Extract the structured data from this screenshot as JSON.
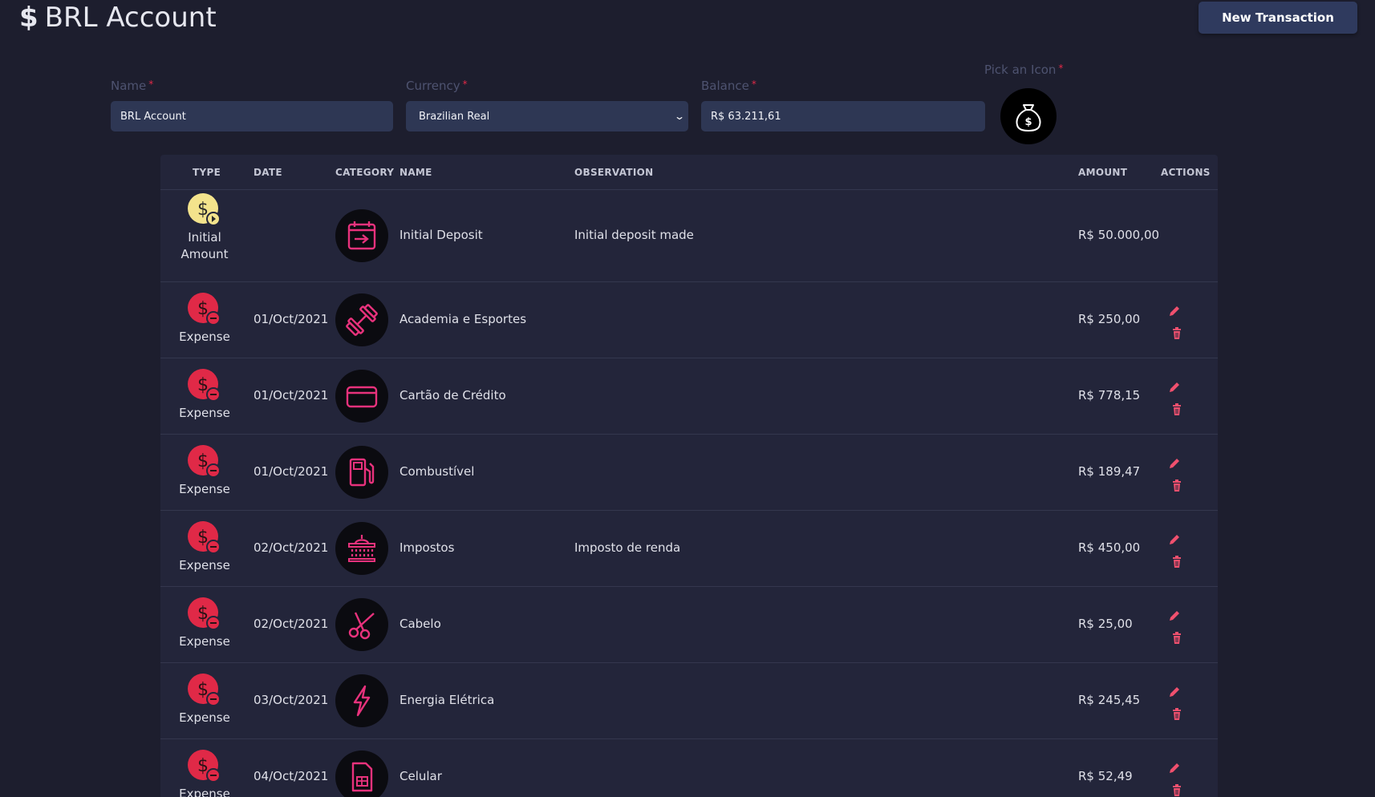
{
  "header": {
    "title": "BRL Account",
    "title_icon": "dollar-icon",
    "new_transaction_label": "New Transaction"
  },
  "form": {
    "name_label": "Name",
    "name_value": "BRL Account",
    "currency_label": "Currency",
    "currency_value": "Brazilian Real",
    "balance_label": "Balance",
    "balance_value": "R$ 63.211,61",
    "icon_label": "Pick an Icon",
    "icon_selected": "money-bag-icon",
    "required_marker": "*"
  },
  "table": {
    "columns": {
      "type": "TYPE",
      "date": "DATE",
      "category": "CATEGORY",
      "name": "NAME",
      "observation": "OBSERVATION",
      "amount": "AMOUNT",
      "actions": "ACTIONS"
    },
    "rows": [
      {
        "type": "Initial Amount",
        "type_icon": "initial-amount-icon",
        "date": "",
        "category_icon": "calendar-arrow-icon",
        "name": "Initial Deposit",
        "observation": "Initial deposit made",
        "amount": "R$ 50.000,00"
      },
      {
        "type": "Expense",
        "type_icon": "expense-icon",
        "date": "01/Oct/2021",
        "category_icon": "dumbbell-icon",
        "name": "Academia e Esportes",
        "observation": "",
        "amount": "R$ 250,00"
      },
      {
        "type": "Expense",
        "type_icon": "expense-icon",
        "date": "01/Oct/2021",
        "category_icon": "credit-card-icon",
        "name": "Cartão de Crédito",
        "observation": "",
        "amount": "R$ 778,15"
      },
      {
        "type": "Expense",
        "type_icon": "expense-icon",
        "date": "01/Oct/2021",
        "category_icon": "fuel-pump-icon",
        "name": "Combustível",
        "observation": "",
        "amount": "R$ 189,47"
      },
      {
        "type": "Expense",
        "type_icon": "expense-icon",
        "date": "02/Oct/2021",
        "category_icon": "government-building-icon",
        "name": "Impostos",
        "observation": "Imposto de renda",
        "amount": "R$ 450,00"
      },
      {
        "type": "Expense",
        "type_icon": "expense-icon",
        "date": "02/Oct/2021",
        "category_icon": "scissors-icon",
        "name": "Cabelo",
        "observation": "",
        "amount": "R$ 25,00"
      },
      {
        "type": "Expense",
        "type_icon": "expense-icon",
        "date": "03/Oct/2021",
        "category_icon": "lightning-icon",
        "name": "Energia Elétrica",
        "observation": "",
        "amount": "R$ 245,45"
      },
      {
        "type": "Expense",
        "type_icon": "expense-icon",
        "date": "04/Oct/2021",
        "category_icon": "sim-card-icon",
        "name": "Celular",
        "observation": "",
        "amount": "R$ 52,49"
      }
    ]
  },
  "colors": {
    "background": "#1d1e2e",
    "table_background": "#23253a",
    "input_background": "#2e3754",
    "button_background": "#2f3a5e",
    "expense_red": "#e02947",
    "initial_yellow": "#f3e38c",
    "category_pink": "#e8327c",
    "action_pink": "#f0506e"
  }
}
